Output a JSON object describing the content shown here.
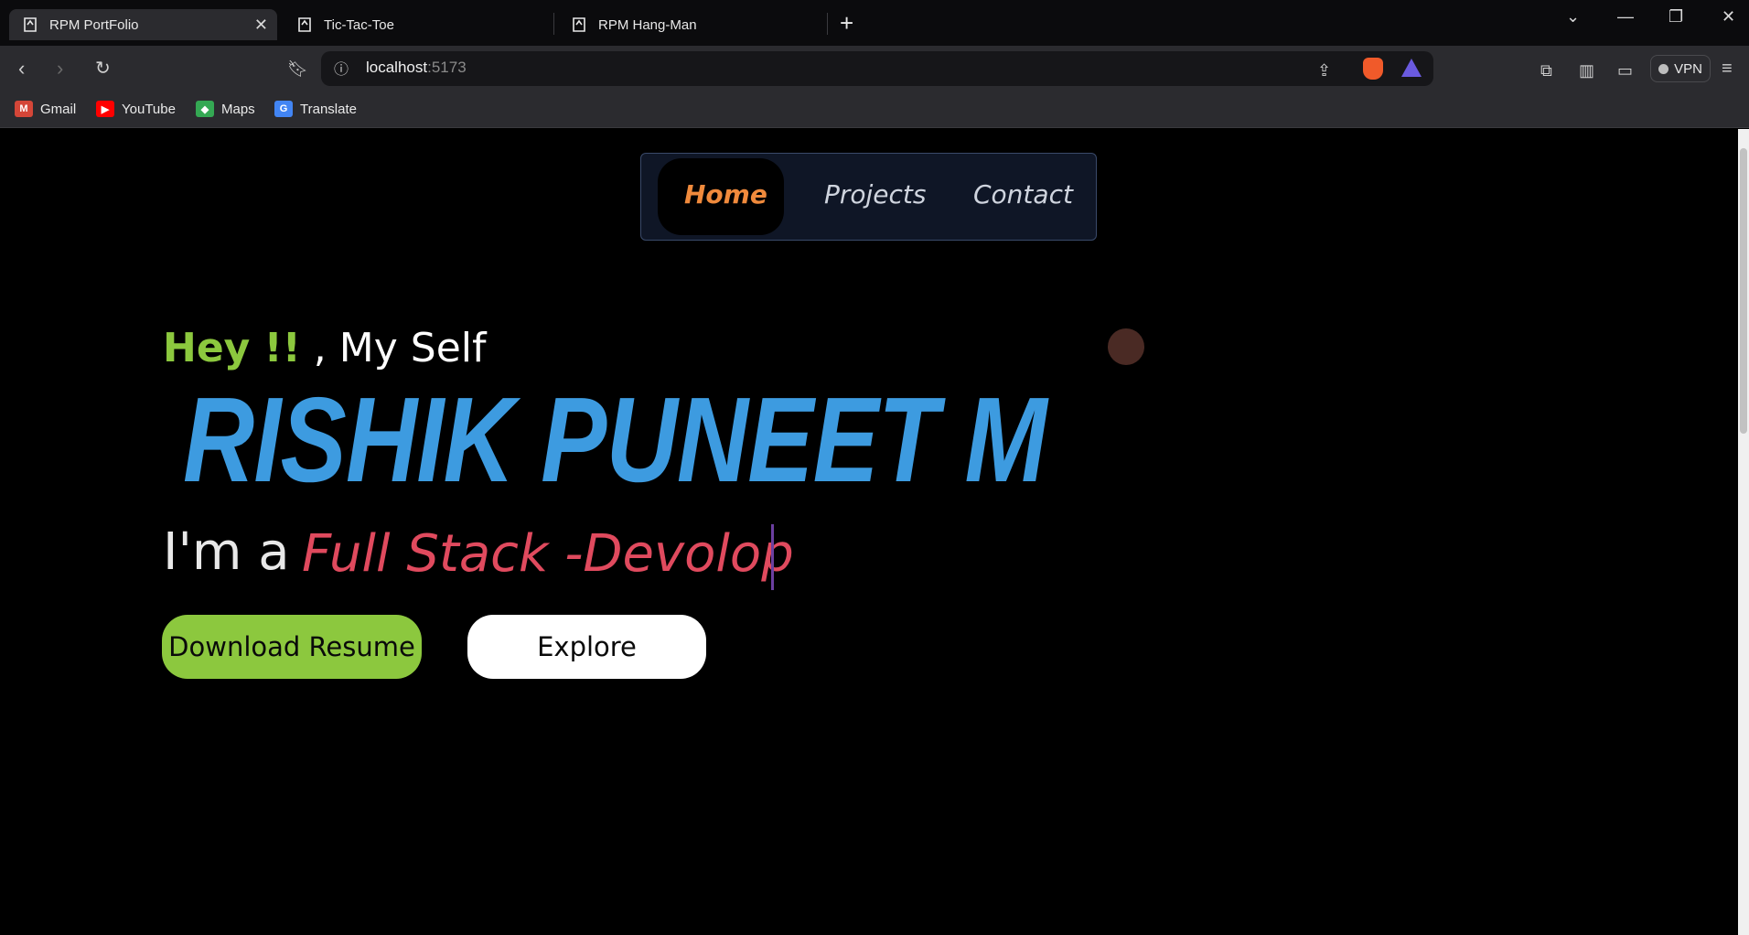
{
  "browser": {
    "tabs": [
      {
        "title": "RPM PortFolio",
        "active": true
      },
      {
        "title": "Tic-Tac-Toe",
        "active": false
      },
      {
        "title": "RPM Hang-Man",
        "active": false
      }
    ],
    "new_tab_icon": "plus-icon",
    "url_host": "localhost",
    "url_port": ":5173",
    "vpn_label": "VPN",
    "bookmarks": [
      {
        "label": "Gmail",
        "icon": "gmail-icon",
        "color": "#d44638"
      },
      {
        "label": "YouTube",
        "icon": "youtube-icon",
        "color": "#ff0000"
      },
      {
        "label": "Maps",
        "icon": "maps-icon",
        "color": "#34a853"
      },
      {
        "label": "Translate",
        "icon": "translate-icon",
        "color": "#4285f4"
      }
    ]
  },
  "nav": {
    "items": [
      "Home",
      "Projects",
      "Contact"
    ],
    "active": "Home"
  },
  "hero": {
    "hey": "Hey !!",
    "intro": " , My Self",
    "name": "RISHIK PUNEET M",
    "role_prefix": "I'm a",
    "role_typed": "Full Stack -Devolop",
    "resume_button": "Download Resume",
    "explore_button": "Explore"
  },
  "colors": {
    "accent_green": "#8cc83e",
    "name_blue": "#3d9be0",
    "role_red": "#e04a5e",
    "nav_active": "#f08a3c"
  }
}
